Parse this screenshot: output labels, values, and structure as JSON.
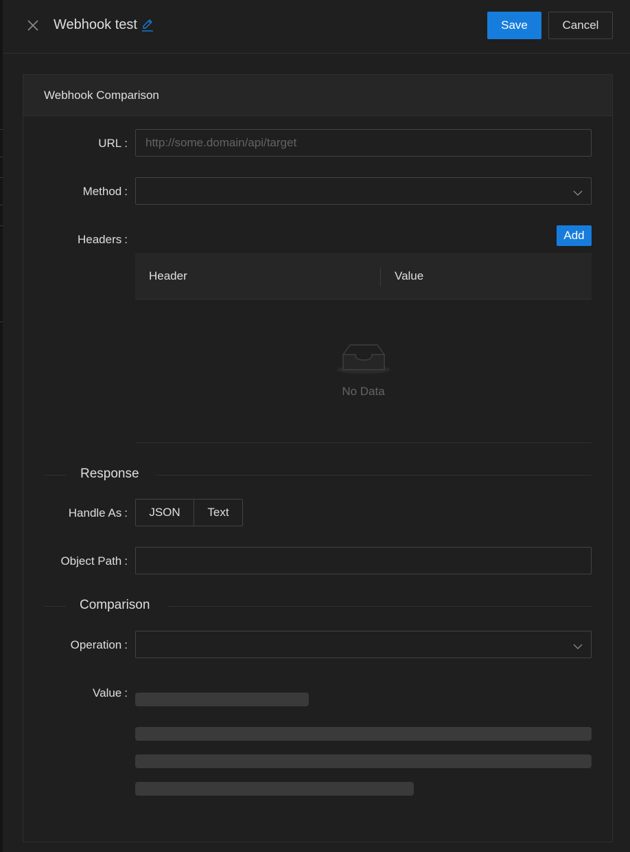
{
  "header": {
    "title": "Webhook test",
    "save_label": "Save",
    "cancel_label": "Cancel"
  },
  "card": {
    "title": "Webhook Comparison"
  },
  "form": {
    "url": {
      "label": "URL",
      "placeholder": "http://some.domain/api/target",
      "value": ""
    },
    "method": {
      "label": "Method",
      "value": ""
    },
    "headers": {
      "label": "Headers",
      "add_label": "Add",
      "columns": [
        "Header",
        "Value"
      ],
      "empty_text": "No Data"
    },
    "response_section": "Response",
    "handle_as": {
      "label": "Handle As",
      "options": [
        "JSON",
        "Text"
      ]
    },
    "object_path": {
      "label": "Object Path",
      "value": ""
    },
    "comparison_section": "Comparison",
    "operation": {
      "label": "Operation",
      "value": ""
    },
    "value": {
      "label": "Value"
    }
  },
  "colon": ":",
  "colors": {
    "primary": "#177ddc",
    "background": "#1f1f1f",
    "border": "#434343"
  }
}
